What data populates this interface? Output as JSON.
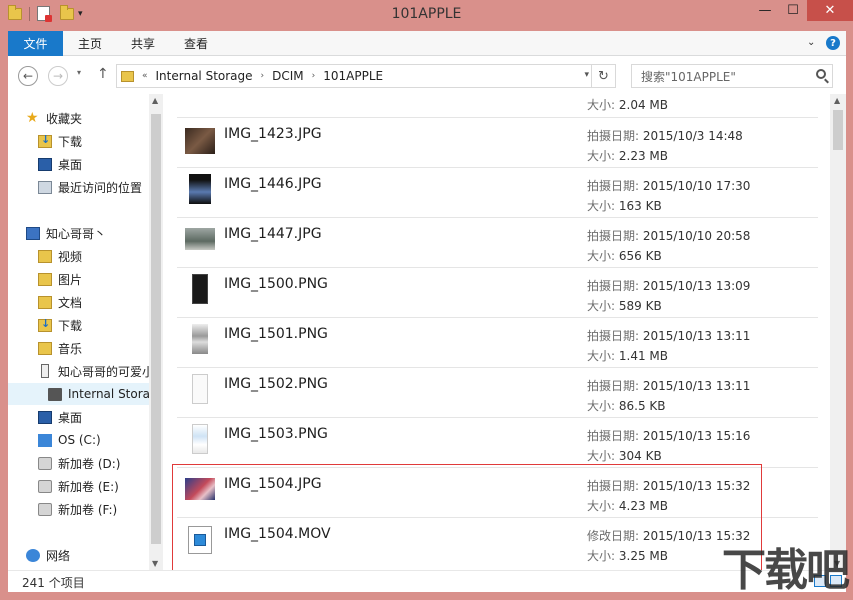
{
  "window": {
    "title": "101APPLE",
    "min_glyph": "—",
    "max_glyph": "☐",
    "close_glyph": "✕"
  },
  "ribbon": {
    "file_tab": "文件",
    "tabs": [
      "主页",
      "共享",
      "查看"
    ],
    "help": "?"
  },
  "address": {
    "crumbs": [
      "Internal Storage",
      "DCIM",
      "101APPLE"
    ],
    "search_placeholder": "搜索\"101APPLE\""
  },
  "nav": {
    "items": [
      {
        "label": "收藏夹",
        "icon": "star-icon"
      },
      {
        "label": "下载",
        "icon": "downloads-folder-icon"
      },
      {
        "label": "桌面",
        "icon": "desktop-icon"
      },
      {
        "label": "最近访问的位置",
        "icon": "recent-places-icon"
      },
      {
        "label": "知心哥哥丶",
        "icon": "computer-icon"
      },
      {
        "label": "视频",
        "icon": "videos-folder-icon"
      },
      {
        "label": "图片",
        "icon": "pictures-folder-icon"
      },
      {
        "label": "文档",
        "icon": "documents-folder-icon"
      },
      {
        "label": "下载",
        "icon": "downloads-folder-icon"
      },
      {
        "label": "音乐",
        "icon": "music-folder-icon"
      },
      {
        "label": "知心哥哥的可爱小",
        "icon": "phone-icon"
      },
      {
        "label": "Internal Stora",
        "icon": "storage-icon"
      },
      {
        "label": "桌面",
        "icon": "desktop-folder-icon"
      },
      {
        "label": "OS (C:)",
        "icon": "windows-drive-icon"
      },
      {
        "label": "新加卷 (D:)",
        "icon": "drive-icon"
      },
      {
        "label": "新加卷 (E:)",
        "icon": "drive-icon"
      },
      {
        "label": "新加卷 (F:)",
        "icon": "drive-icon"
      },
      {
        "label": "网络",
        "icon": "network-icon"
      }
    ]
  },
  "files": {
    "partial_size_label": "大小:",
    "partial_size": "2.04 MB",
    "items": [
      {
        "name": "IMG_1423.JPG",
        "date_label": "拍摄日期:",
        "date": "2015/10/3 14:48",
        "size_label": "大小:",
        "size": "2.23 MB",
        "thumb": "photo-dark"
      },
      {
        "name": "IMG_1446.JPG",
        "date_label": "拍摄日期:",
        "date": "2015/10/10 17:30",
        "size_label": "大小:",
        "size": "163 KB",
        "thumb": "photo-night"
      },
      {
        "name": "IMG_1447.JPG",
        "date_label": "拍摄日期:",
        "date": "2015/10/10 20:58",
        "size_label": "大小:",
        "size": "656 KB",
        "thumb": "photo-grey"
      },
      {
        "name": "IMG_1500.PNG",
        "date_label": "拍摄日期:",
        "date": "2015/10/13 13:09",
        "size_label": "大小:",
        "size": "589 KB",
        "thumb": "screenshot-dark"
      },
      {
        "name": "IMG_1501.PNG",
        "date_label": "拍摄日期:",
        "date": "2015/10/13 13:11",
        "size_label": "大小:",
        "size": "1.41 MB",
        "thumb": "screenshot-light"
      },
      {
        "name": "IMG_1502.PNG",
        "date_label": "拍摄日期:",
        "date": "2015/10/13 13:11",
        "size_label": "大小:",
        "size": "86.5 KB",
        "thumb": "screenshot-white"
      },
      {
        "name": "IMG_1503.PNG",
        "date_label": "拍摄日期:",
        "date": "2015/10/13 15:16",
        "size_label": "大小:",
        "size": "304 KB",
        "thumb": "screenshot-blue"
      },
      {
        "name": "IMG_1504.JPG",
        "date_label": "拍摄日期:",
        "date": "2015/10/13 15:32",
        "size_label": "大小:",
        "size": "4.23 MB",
        "thumb": "photo-blue"
      },
      {
        "name": "IMG_1504.MOV",
        "date_label": "修改日期:",
        "date": "2015/10/13 15:32",
        "size_label": "大小:",
        "size": "3.25 MB",
        "thumb": "video-file"
      }
    ]
  },
  "status": {
    "count": "241 个项目"
  },
  "colors": {
    "accent": "#1979ca",
    "frame": "#d9908b",
    "highlight_box": "#e03a3a"
  }
}
